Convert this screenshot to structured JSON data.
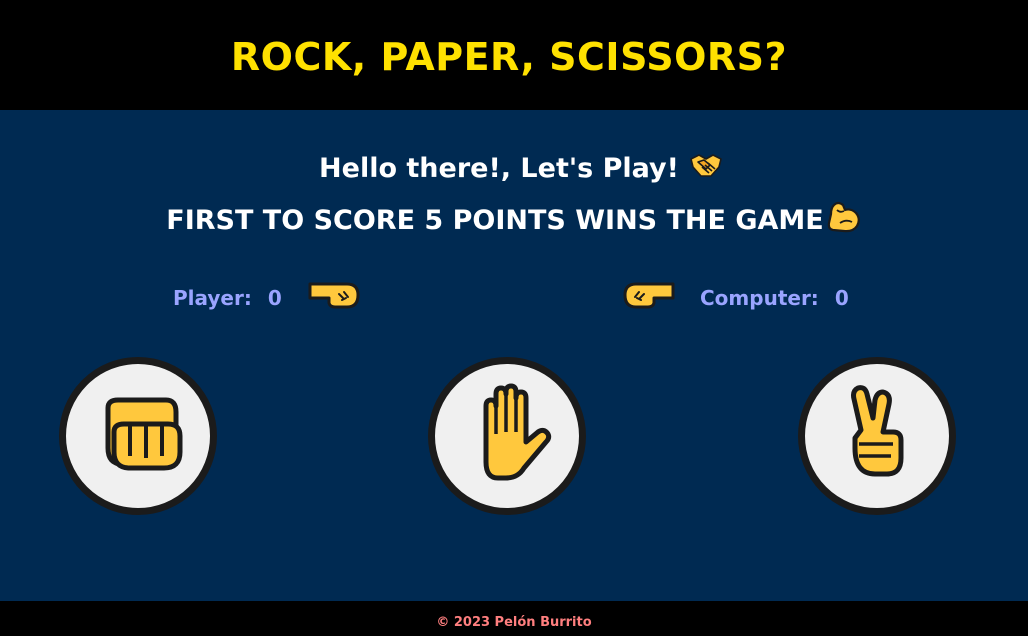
{
  "header": {
    "title": "ROCK, PAPER, SCISSORS?"
  },
  "intro": {
    "greeting": "Hello there!, Let's Play!",
    "greeting_icon": "handshake-icon",
    "rules": "FIRST TO SCORE 5 POINTS WINS THE GAME",
    "rules_icon": "flexed-biceps-icon"
  },
  "scoreboard": {
    "player_label": "Player:",
    "player_score": "0",
    "player_hand_icon": "right-facing-fist-icon",
    "computer_label": "Computer:",
    "computer_score": "0",
    "computer_hand_icon": "left-facing-fist-icon"
  },
  "choices": [
    {
      "name": "rock",
      "icon": "oncoming-fist-icon"
    },
    {
      "name": "paper",
      "icon": "raised-hand-icon"
    },
    {
      "name": "scissors",
      "icon": "victory-hand-icon"
    }
  ],
  "footer": {
    "copyright": "© 2023 Pelón Burrito"
  },
  "colors": {
    "header_bg": "#000000",
    "title": "#ffe100",
    "main_bg": "#002a52",
    "text": "#ffffff",
    "score_text": "#9aa4ff",
    "footer_text": "#ff7f7f",
    "emoji_fill": "#ffc83d"
  }
}
